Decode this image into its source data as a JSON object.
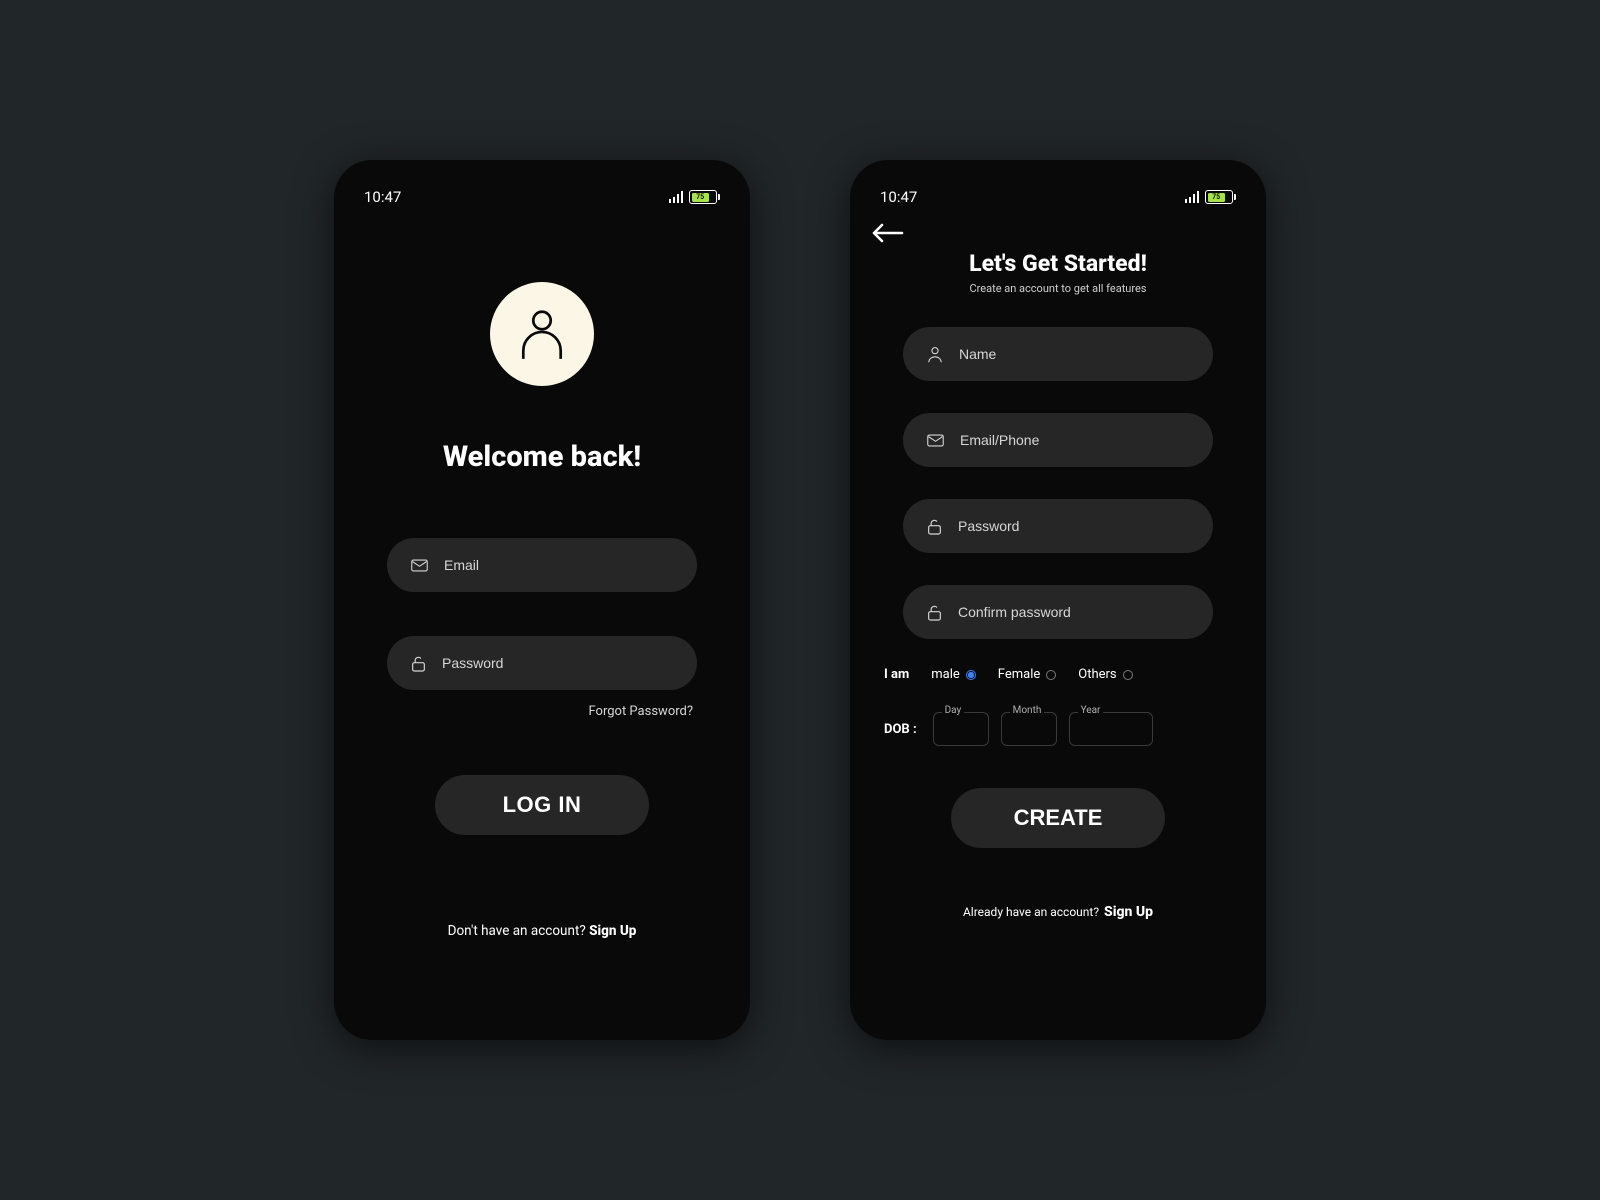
{
  "status": {
    "time": "10:47",
    "battery_level": "75"
  },
  "login": {
    "heading": "Welcome back!",
    "email_placeholder": "Email",
    "password_placeholder": "Password",
    "forgot": "Forgot Password?",
    "submit": "LOG IN",
    "footer_prompt": "Don't have an account?",
    "footer_action": "Sign Up"
  },
  "signup": {
    "heading": "Let's Get Started!",
    "subheading": "Create an account to get all features",
    "name_placeholder": "Name",
    "email_placeholder": "Email/Phone",
    "password_placeholder": "Password",
    "confirm_placeholder": "Confirm password",
    "gender_label": "I am",
    "gender_options": {
      "male": "male",
      "female": "Female",
      "others": "Others"
    },
    "gender_selected": "male",
    "dob_label": "DOB :",
    "dob_day": "Day",
    "dob_month": "Month",
    "dob_year": "Year",
    "submit": "CREATE",
    "footer_prompt": "Already have an account?",
    "footer_action": "Sign Up"
  }
}
